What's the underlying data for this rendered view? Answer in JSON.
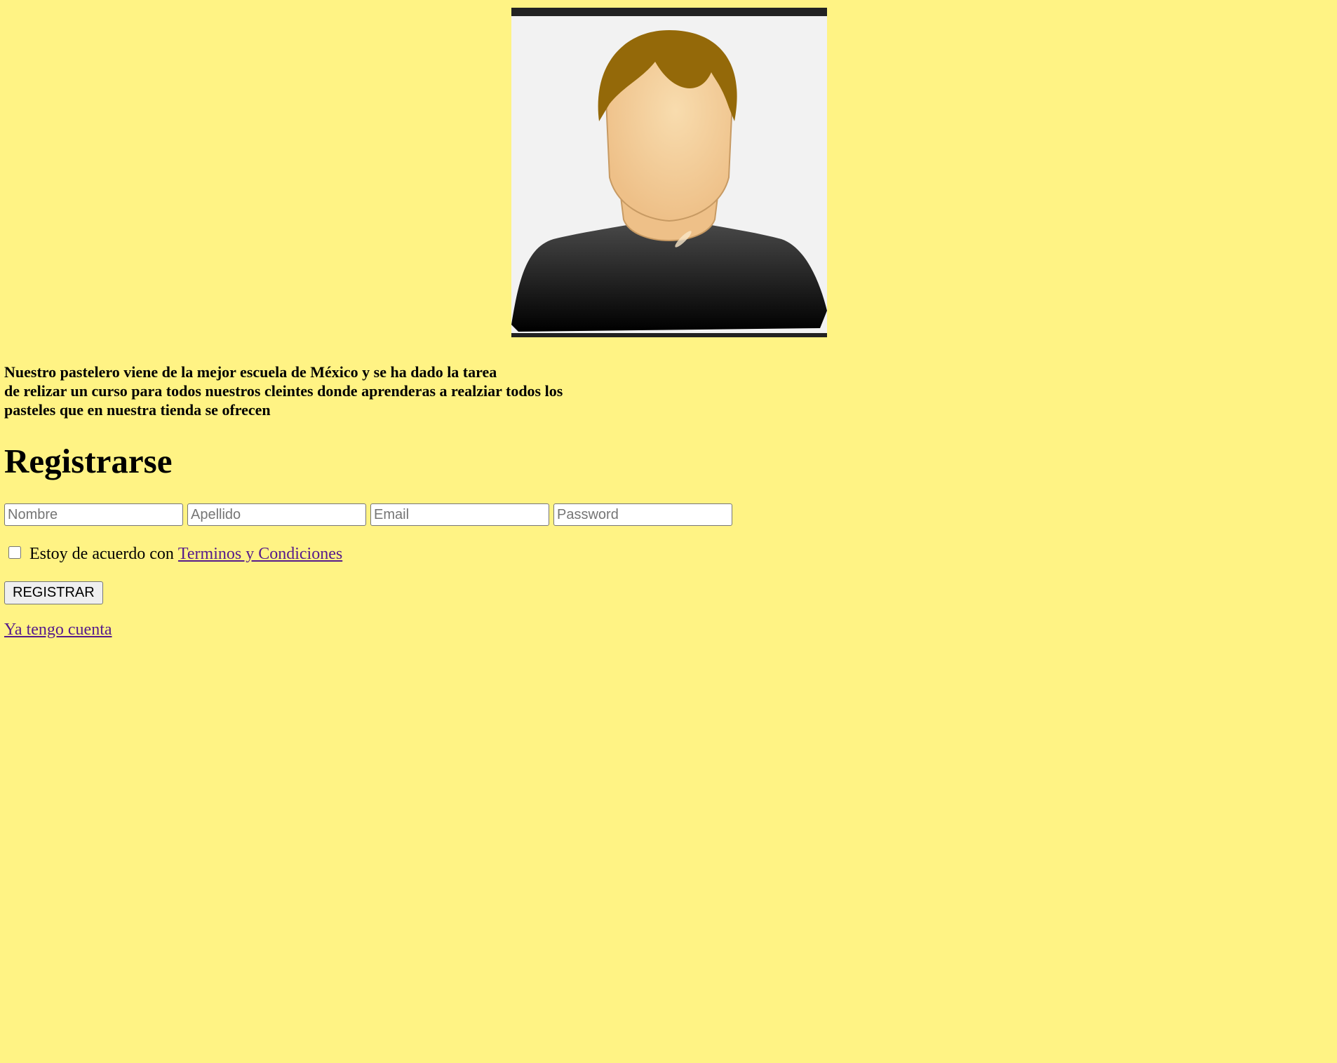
{
  "profile": {
    "avatar_icon": "person-avatar-icon",
    "description_lines": [
      "Nuestro pastelero viene de la mejor escuela de México y se ha dado la tarea",
      "de relizar un curso para todos nuestros cleintes donde aprenderas a realziar todos los",
      "pasteles que en nuestra tienda se ofrecen"
    ]
  },
  "register": {
    "title": "Registrarse",
    "fields": {
      "nombre_placeholder": "Nombre",
      "apellido_placeholder": "Apellido",
      "email_placeholder": "Email",
      "password_placeholder": "Password"
    },
    "terms": {
      "text": "Estoy de acuerdo con",
      "link_text": "Terminos y Condiciones"
    },
    "submit_label": "REGISTRAR",
    "login_link": "Ya tengo cuenta"
  },
  "colors": {
    "background": "#fff384",
    "link": "#551a8b",
    "frame": "#222222"
  }
}
